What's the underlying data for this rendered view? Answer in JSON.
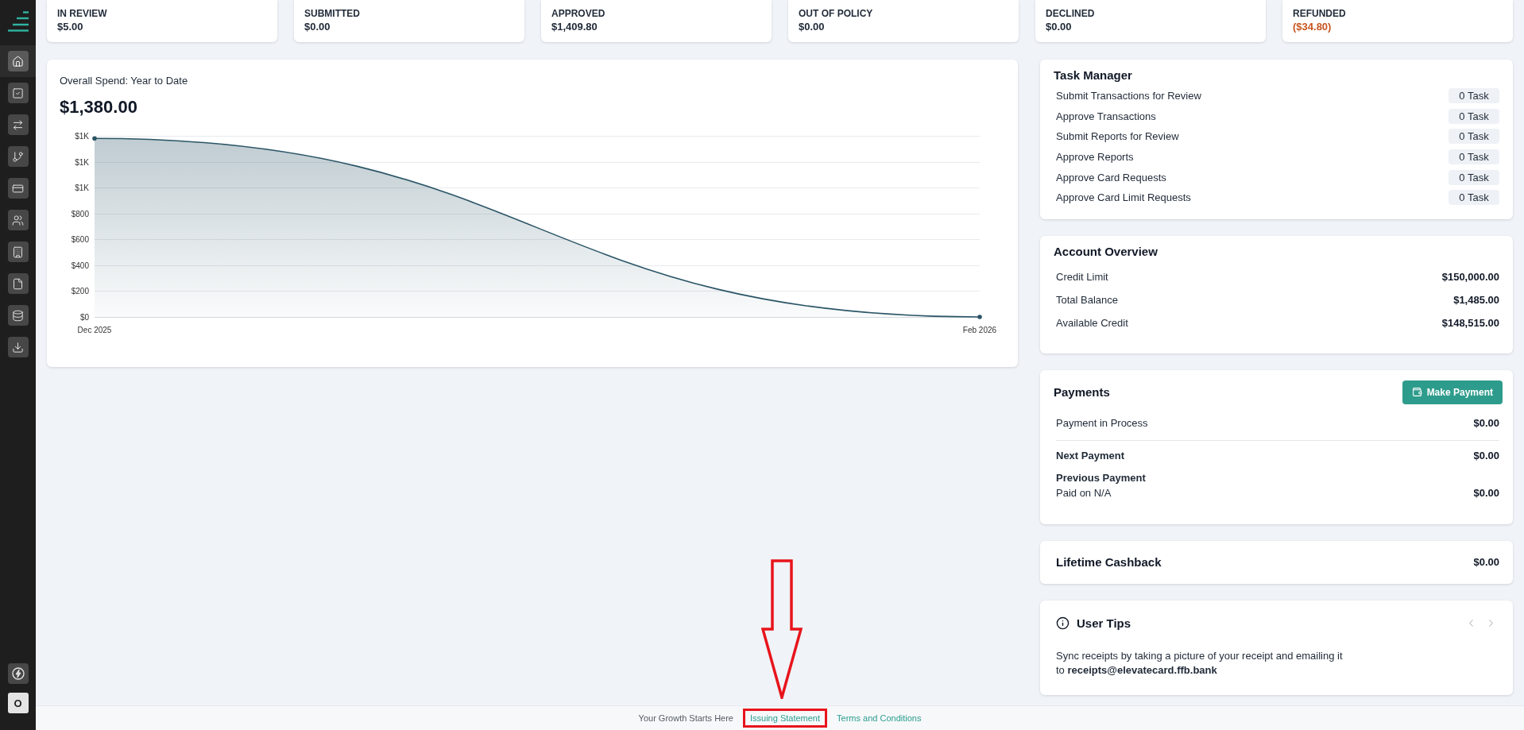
{
  "sidebar": {
    "items": [
      {
        "selected": true
      },
      {
        "selected": false
      },
      {
        "selected": false
      },
      {
        "selected": false
      },
      {
        "selected": false
      },
      {
        "selected": false
      },
      {
        "selected": false
      },
      {
        "selected": false
      },
      {
        "selected": false
      },
      {
        "selected": false
      }
    ],
    "avatar": "O"
  },
  "summary_cards": [
    {
      "label": "IN REVIEW",
      "amount": "$5.00",
      "negative": false
    },
    {
      "label": "SUBMITTED",
      "amount": "$0.00",
      "negative": false
    },
    {
      "label": "APPROVED",
      "amount": "$1,409.80",
      "negative": false
    },
    {
      "label": "OUT OF POLICY",
      "amount": "$0.00",
      "negative": false
    },
    {
      "label": "DECLINED",
      "amount": "$0.00",
      "negative": false
    },
    {
      "label": "REFUNDED",
      "amount": "($34.80)",
      "negative": true
    }
  ],
  "overall_spend": {
    "title": "Overall Spend: Year to Date",
    "total": "$1,380.00",
    "chart_data": {
      "type": "area",
      "categories": [
        "Dec 2025",
        "Feb 2026"
      ],
      "series": [
        {
          "color": "#2b5566",
          "values": [
            1380,
            0
          ]
        }
      ],
      "ylim": [
        0,
        1400
      ],
      "yticks": [
        {
          "value": 0,
          "label": "$0"
        },
        {
          "value": 200,
          "label": "$200"
        },
        {
          "value": 400,
          "label": "$400"
        },
        {
          "value": 600,
          "label": "$600"
        },
        {
          "value": 800,
          "label": "$800"
        },
        {
          "value": 1000,
          "label": "$1K"
        },
        {
          "value": 1200,
          "label": "$1K"
        },
        {
          "value": 1400,
          "label": "$1K"
        }
      ]
    }
  },
  "task_manager": {
    "title": "Task Manager",
    "tasks": [
      {
        "label": "Submit Transactions for Review",
        "count": "0 Task"
      },
      {
        "label": "Approve Transactions",
        "count": "0 Task"
      },
      {
        "label": "Submit Reports for Review",
        "count": "0 Task"
      },
      {
        "label": "Approve Reports",
        "count": "0 Task"
      },
      {
        "label": "Approve Card Requests",
        "count": "0 Task"
      },
      {
        "label": "Approve Card Limit Requests",
        "count": "0 Task"
      }
    ]
  },
  "account_overview": {
    "title": "Account Overview",
    "rows": [
      {
        "label": "Credit Limit",
        "value": "$150,000.00"
      },
      {
        "label": "Total Balance",
        "value": "$1,485.00"
      },
      {
        "label": "Available Credit",
        "value": "$148,515.00"
      }
    ]
  },
  "payments": {
    "title": "Payments",
    "button": "Make Payment",
    "in_process": {
      "label": "Payment in Process",
      "value": "$0.00"
    },
    "next": {
      "label": "Next Payment",
      "value": "$0.00"
    },
    "previous": {
      "label": "Previous Payment",
      "detail": "Paid on N/A",
      "value": "$0.00"
    }
  },
  "lifetime_cashback": {
    "label": "Lifetime Cashback",
    "value": "$0.00"
  },
  "user_tips": {
    "title": "User Tips",
    "text": "Sync receipts by taking a picture of your receipt and emailing it\nto **receipts@elevatecard.ffb.bank**"
  },
  "footer": {
    "items": [
      {
        "kind": "text",
        "label": "Your Growth Starts Here",
        "highlighted": false,
        "pointed_at": false
      },
      {
        "kind": "link",
        "label": "Issuing Statement",
        "highlighted": true,
        "pointed_at": true
      },
      {
        "kind": "link",
        "label": "Terms and Conditions",
        "highlighted": false,
        "pointed_at": false
      }
    ]
  }
}
